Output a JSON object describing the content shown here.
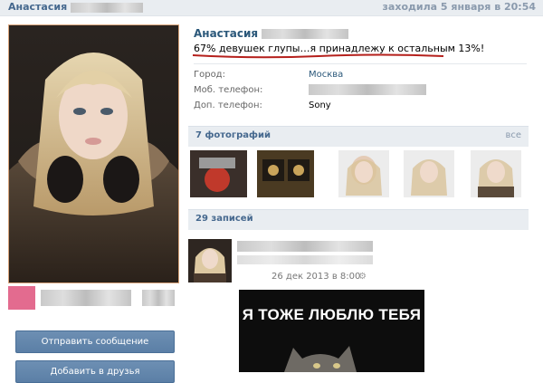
{
  "header": {
    "user_name": "Анастасия",
    "last_seen": "заходила 5 января в 20:54"
  },
  "profile": {
    "name": "Анастасия",
    "status": "67% девушек глупы…я принадлежу к остальным 13%!",
    "fields": [
      {
        "label": "Город:",
        "value": "Москва",
        "is_link": true
      },
      {
        "label": "Моб. телефон:",
        "value": ""
      },
      {
        "label": "Доп. телефон:",
        "value": "Sony"
      }
    ]
  },
  "photos": {
    "title": "7 фотографий",
    "all_link": "все"
  },
  "posts": {
    "title": "29 записей",
    "items": [
      {
        "date": "26 дек 2013 в 8:00",
        "image_caption": "Я ТОЖЕ ЛЮБЛЮ ТЕБЯ"
      }
    ]
  },
  "actions": {
    "send_message": "Отправить сообщение",
    "add_friend": "Добавить в друзья"
  },
  "colors": {
    "accent": "#45688e",
    "button": "#5b7fa6",
    "section_bg": "#e9edf1"
  }
}
